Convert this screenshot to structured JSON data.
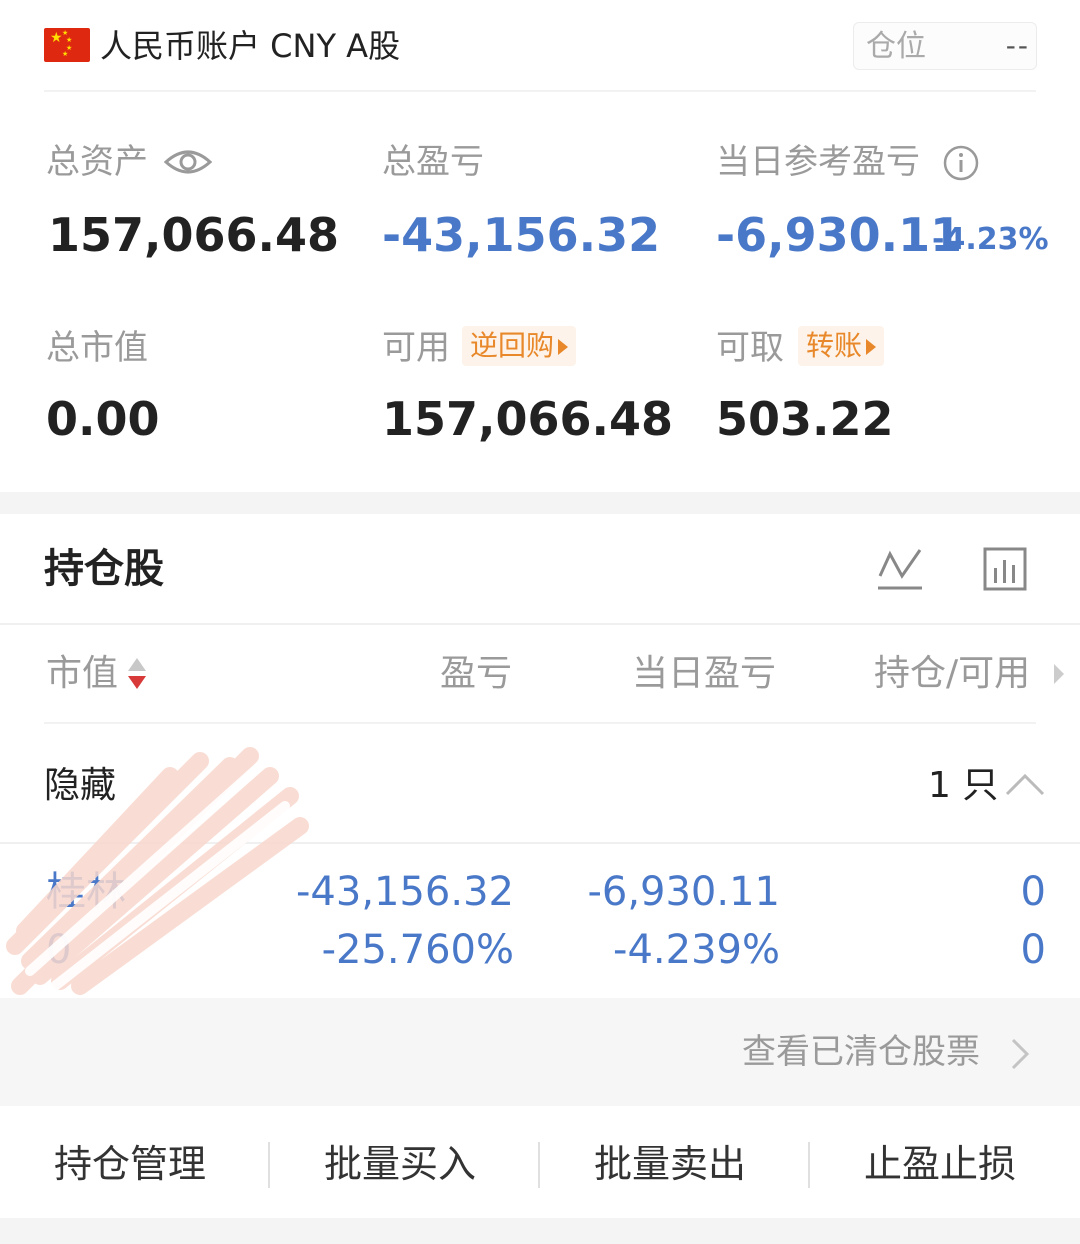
{
  "header": {
    "account": "人民币账户 CNY A股",
    "position_label": "仓位",
    "position_value": "--"
  },
  "summary": {
    "total_assets_label": "总资产",
    "total_assets": "157,066.48",
    "total_pnl_label": "总盈亏",
    "total_pnl": "-43,156.32",
    "daily_pnl_label": "当日参考盈亏",
    "daily_pnl": "-6,930.11",
    "daily_pnl_pct": "-4.23%",
    "market_value_label": "总市值",
    "market_value": "0.00",
    "available_label": "可用",
    "reverse_repo_tag": "逆回购",
    "available": "157,066.48",
    "withdrawable_label": "可取",
    "transfer_tag": "转账",
    "withdrawable": "503.22"
  },
  "holdings": {
    "title": "持仓股",
    "columns": [
      "市值",
      "盈亏",
      "当日盈亏",
      "持仓/可用"
    ],
    "hidden_label": "隐藏",
    "hidden_count": "1 只",
    "rows": [
      {
        "name": "桂林",
        "market_value": "0",
        "pnl": "-43,156.32",
        "pnl_pct": "-25.760%",
        "daily_pnl": "-6,930.11",
        "daily_pnl_pct": "-4.239%",
        "position": "0",
        "available": "0"
      }
    ],
    "cleared_link": "查看已清仓股票"
  },
  "actions": [
    "持仓管理",
    "批量买入",
    "批量卖出",
    "止盈止损"
  ],
  "colors": {
    "negative": "#4a78c8",
    "tag": "#e8882a",
    "flag": "#de2910"
  }
}
